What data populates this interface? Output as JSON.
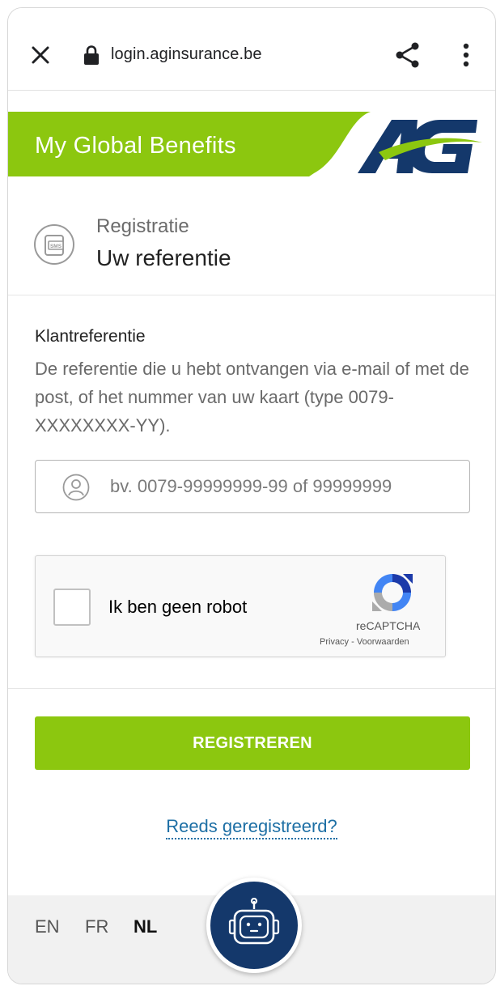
{
  "browser": {
    "url": "login.aginsurance.be",
    "icons": [
      "close-icon",
      "lock-icon",
      "share-icon",
      "more-vert-icon"
    ]
  },
  "header": {
    "title": "My Global Benefits",
    "logo_text": "AG",
    "colors": {
      "band": "#8cc70f",
      "logo_blue": "#14386b",
      "logo_green": "#8cc70f"
    }
  },
  "step": {
    "label": "Registratie",
    "title": "Uw referentie",
    "icon_text": "SMS"
  },
  "form": {
    "field_label": "Klantreferentie",
    "field_help": "De referentie die u hebt ontvangen via e-mail of met de post, of het nummer van uw kaart (type 0079-XXXXXXXX-YY).",
    "input_placeholder": "bv. 0079-99999999-99 of 99999999",
    "input_value": ""
  },
  "captcha": {
    "label": "Ik ben geen robot",
    "brand": "reCAPTCHA",
    "privacy": "Privacy",
    "separator": " - ",
    "terms": "Voorwaarden"
  },
  "actions": {
    "register_label": "REGISTREREN",
    "already_registered": "Reeds geregistreerd?",
    "button_color": "#8cc70f",
    "link_color": "#1d6fa5"
  },
  "footer": {
    "languages": [
      {
        "code": "EN",
        "active": false
      },
      {
        "code": "FR",
        "active": false
      },
      {
        "code": "NL",
        "active": true
      }
    ],
    "chatbot_icon": "robot-icon"
  }
}
